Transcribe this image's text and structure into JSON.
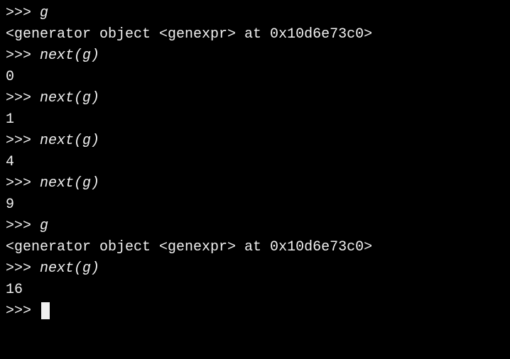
{
  "prompt": ">>> ",
  "lines": [
    {
      "type": "input",
      "text": "g"
    },
    {
      "type": "output",
      "text": "<generator object <genexpr> at 0x10d6e73c0>"
    },
    {
      "type": "input",
      "text": "next(g)"
    },
    {
      "type": "output",
      "text": "0"
    },
    {
      "type": "input",
      "text": "next(g)"
    },
    {
      "type": "output",
      "text": "1"
    },
    {
      "type": "input",
      "text": "next(g)"
    },
    {
      "type": "output",
      "text": "4"
    },
    {
      "type": "input",
      "text": "next(g)"
    },
    {
      "type": "output",
      "text": "9"
    },
    {
      "type": "input",
      "text": "g"
    },
    {
      "type": "output",
      "text": "<generator object <genexpr> at 0x10d6e73c0>"
    },
    {
      "type": "input",
      "text": "next(g)"
    },
    {
      "type": "output",
      "text": "16"
    },
    {
      "type": "cursor",
      "text": ""
    }
  ]
}
